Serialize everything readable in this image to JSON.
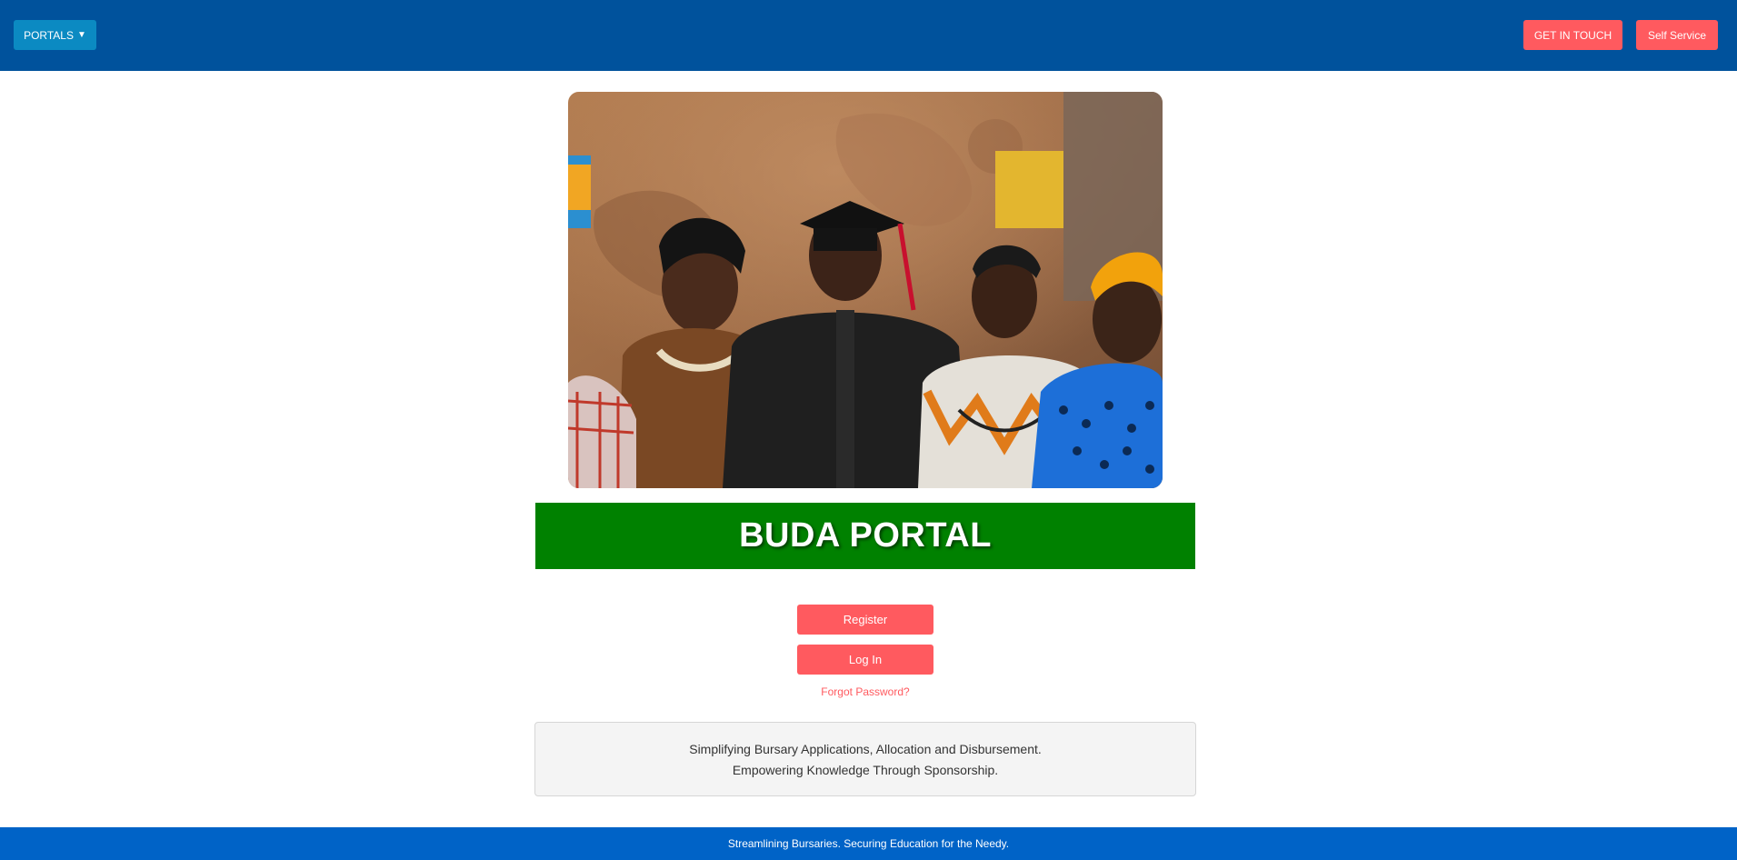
{
  "header": {
    "portals_label": "PORTALS",
    "caret": "▼",
    "get_in_touch_label": "GET IN TOUCH",
    "self_service_label": "Self Service"
  },
  "hero": {
    "image_description": "graduation-photo"
  },
  "banner": {
    "title": "BUDA PORTAL"
  },
  "actions": {
    "register_label": "Register",
    "login_label": "Log In",
    "forgot_password_label": "Forgot Password?"
  },
  "tagline": {
    "line1": "Simplifying Bursary Applications, Allocation and Disbursement.",
    "line2": "Empowering Knowledge Through Sponsorship."
  },
  "footer": {
    "text": "Streamlining Bursaries. Securing Education for the Needy."
  },
  "colors": {
    "header_bg": "#00529c",
    "portals_bg": "#0b8ac2",
    "accent": "#ff5a5f",
    "banner_bg": "#008100",
    "footer_bg": "#0063c7"
  }
}
